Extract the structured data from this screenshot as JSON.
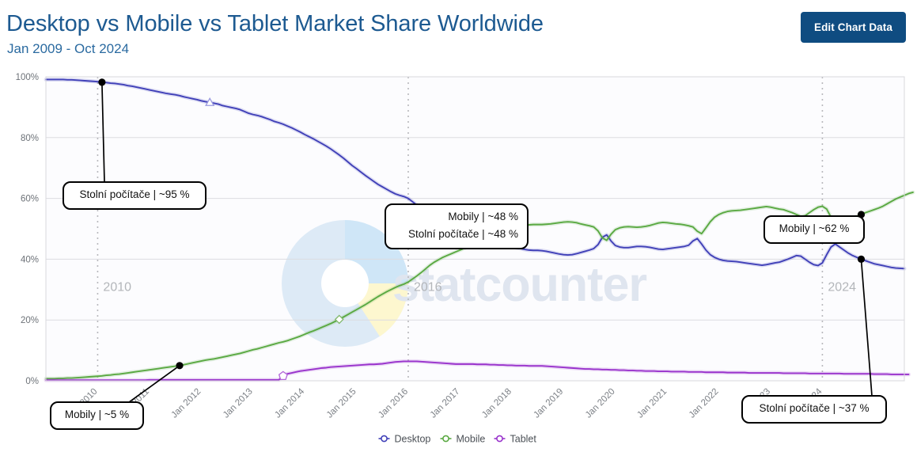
{
  "header": {
    "title": "Desktop vs Mobile vs Tablet Market Share Worldwide",
    "subtitle": "Jan 2009 - Oct 2024",
    "edit_button_label": "Edit Chart Data",
    "title_color": "#1d5a91",
    "button_color": "#0f4c81"
  },
  "watermark": {
    "text": "statcounter"
  },
  "chart_data": {
    "type": "line",
    "title": "Desktop vs Mobile vs Tablet Market Share Worldwide",
    "subtitle": "Jan 2009 - Oct 2024",
    "xlabel": "",
    "ylabel": "",
    "ylim": [
      0,
      100
    ],
    "ytick_labels": [
      "0%",
      "20%",
      "40%",
      "60%",
      "80%",
      "100%"
    ],
    "ytick_values": [
      0,
      20,
      40,
      60,
      80,
      100
    ],
    "grid": true,
    "legend_position": "bottom",
    "x_start": "Jan 2009",
    "x_end": "Oct 2024",
    "xtick_labels": [
      "Jan 2010",
      "Jan 2011",
      "Jan 2012",
      "Jan 2013",
      "Jan 2014",
      "Jan 2015",
      "Jan 2016",
      "Jan 2017",
      "Jan 2018",
      "Jan 2019",
      "Jan 2020",
      "Jan 2021",
      "Jan 2022",
      "Jan 2023",
      "Jan 2024"
    ],
    "vertical_markers": [
      {
        "label": "2010",
        "x_index": 12
      },
      {
        "label": "2016",
        "x_index": 84
      },
      {
        "label": "2024",
        "x_index": 180
      }
    ],
    "series": [
      {
        "name": "Desktop",
        "color": "#4040b8",
        "values": [
          99.1,
          99.1,
          99.1,
          99.1,
          99.1,
          99.0,
          99.0,
          98.9,
          98.8,
          98.7,
          98.6,
          98.5,
          98.4,
          98.2,
          98.1,
          97.9,
          97.8,
          97.6,
          97.4,
          97.1,
          96.9,
          96.6,
          96.3,
          96.0,
          95.7,
          95.4,
          95.1,
          94.8,
          94.5,
          94.3,
          94.1,
          93.8,
          93.4,
          93.1,
          92.8,
          92.5,
          92.1,
          91.8,
          91.6,
          91.3,
          91.0,
          90.5,
          90.2,
          89.9,
          89.6,
          89.2,
          88.6,
          88.0,
          87.6,
          87.3,
          86.9,
          86.4,
          85.9,
          85.3,
          84.9,
          84.4,
          83.8,
          83.2,
          82.5,
          81.8,
          81.0,
          80.3,
          79.6,
          78.8,
          78.0,
          77.2,
          76.3,
          75.3,
          74.3,
          73.2,
          72.0,
          70.8,
          69.8,
          68.7,
          67.6,
          66.6,
          65.6,
          64.6,
          63.8,
          63.0,
          62.2,
          61.5,
          61.0,
          60.6,
          60.0,
          58.9,
          57.8,
          56.6,
          55.3,
          54.1,
          53.2,
          52.6,
          52.0,
          51.6,
          51.2,
          50.9,
          50.5,
          50.0,
          49.5,
          48.8,
          48.0,
          47.2,
          46.5,
          46.0,
          45.6,
          45.2,
          44.8,
          44.4,
          44.1,
          43.8,
          43.5,
          43.2,
          43.0,
          42.9,
          42.9,
          42.8,
          42.6,
          42.3,
          42.0,
          41.7,
          41.5,
          41.4,
          41.5,
          41.8,
          42.2,
          42.6,
          43.0,
          43.5,
          44.8,
          47.2,
          48.0,
          46.0,
          44.5,
          44.0,
          43.8,
          43.8,
          44.0,
          44.2,
          44.2,
          44.1,
          43.9,
          43.6,
          43.3,
          43.2,
          43.4,
          43.6,
          43.8,
          44.0,
          44.2,
          44.6,
          46.0,
          46.8,
          45.0,
          43.0,
          41.5,
          40.6,
          40.0,
          39.6,
          39.4,
          39.3,
          39.2,
          39.0,
          38.8,
          38.6,
          38.4,
          38.2,
          38.0,
          38.2,
          38.5,
          38.8,
          39.0,
          39.5,
          40.0,
          40.6,
          41.2,
          41.0,
          40.0,
          39.0,
          38.2,
          37.9,
          38.8,
          41.5,
          44.0,
          45.0,
          44.0,
          43.0,
          42.0,
          41.2,
          40.6,
          40.0,
          39.5,
          39.0,
          38.5,
          38.2,
          37.9,
          37.6,
          37.3,
          37.1,
          37.0,
          36.9
        ]
      },
      {
        "name": "Mobile",
        "color": "#5aa942",
        "values": [
          0.7,
          0.7,
          0.7,
          0.8,
          0.8,
          0.9,
          0.9,
          1.0,
          1.1,
          1.2,
          1.3,
          1.4,
          1.5,
          1.6,
          1.8,
          1.9,
          2.1,
          2.2,
          2.4,
          2.6,
          2.8,
          3.0,
          3.2,
          3.4,
          3.6,
          3.8,
          4.0,
          4.2,
          4.4,
          4.6,
          4.8,
          5.0,
          5.3,
          5.6,
          5.9,
          6.2,
          6.5,
          6.8,
          7.0,
          7.2,
          7.5,
          7.8,
          8.1,
          8.4,
          8.7,
          9.0,
          9.4,
          9.8,
          10.2,
          10.5,
          10.9,
          11.3,
          11.7,
          12.1,
          12.5,
          12.8,
          13.2,
          13.7,
          14.2,
          14.7,
          15.3,
          15.9,
          16.4,
          17.0,
          17.6,
          18.2,
          18.8,
          19.5,
          20.2,
          21.0,
          21.8,
          22.6,
          23.4,
          24.2,
          25.0,
          25.9,
          26.8,
          27.7,
          28.5,
          29.3,
          30.0,
          30.7,
          31.3,
          31.8,
          32.5,
          33.5,
          34.5,
          35.6,
          36.8,
          38.0,
          39.0,
          39.8,
          40.6,
          41.2,
          41.8,
          42.4,
          43.0,
          43.6,
          44.3,
          45.0,
          45.8,
          46.6,
          47.3,
          47.9,
          48.4,
          48.9,
          49.4,
          49.8,
          50.2,
          50.5,
          50.8,
          51.1,
          51.3,
          51.4,
          51.4,
          51.4,
          51.5,
          51.6,
          51.8,
          52.0,
          52.2,
          52.3,
          52.2,
          52.0,
          51.6,
          51.3,
          51.0,
          50.6,
          49.3,
          47.0,
          46.2,
          48.2,
          49.7,
          50.3,
          50.6,
          50.7,
          50.6,
          50.5,
          50.6,
          50.8,
          51.1,
          51.5,
          51.9,
          52.1,
          52.0,
          51.8,
          51.6,
          51.5,
          51.3,
          51.0,
          50.6,
          49.2,
          48.4,
          50.3,
          52.3,
          53.8,
          54.7,
          55.3,
          55.7,
          55.9,
          56.0,
          56.1,
          56.3,
          56.5,
          56.7,
          56.9,
          57.1,
          57.3,
          57.1,
          56.8,
          56.5,
          56.3,
          55.8,
          55.3,
          54.7,
          54.1,
          54.3,
          55.3,
          56.3,
          57.1,
          57.4,
          56.5,
          53.8,
          51.3,
          50.3,
          51.3,
          52.3,
          53.3,
          54.1,
          54.7,
          55.3,
          55.8,
          56.3,
          56.8,
          57.4,
          58.2,
          59.0,
          59.8,
          60.4,
          61.0,
          61.6,
          62.0
        ]
      },
      {
        "name": "Tablet",
        "color": "#9933cc",
        "values": [
          0.2,
          0.2,
          0.2,
          0.2,
          0.2,
          0.2,
          0.2,
          0.2,
          0.2,
          0.2,
          0.2,
          0.2,
          0.2,
          0.2,
          0.2,
          0.2,
          0.2,
          0.2,
          0.2,
          0.2,
          0.2,
          0.2,
          0.2,
          0.2,
          0.3,
          0.3,
          0.3,
          0.3,
          0.3,
          0.3,
          0.3,
          0.3,
          0.3,
          0.3,
          0.3,
          0.3,
          0.3,
          0.3,
          0.3,
          0.3,
          0.3,
          0.3,
          0.3,
          0.3,
          0.3,
          0.3,
          0.3,
          0.3,
          0.3,
          0.3,
          0.3,
          0.3,
          0.3,
          0.3,
          0.3,
          1.6,
          2.3,
          2.6,
          2.9,
          3.2,
          3.4,
          3.6,
          3.8,
          4.0,
          4.2,
          4.3,
          4.5,
          4.6,
          4.7,
          4.8,
          4.9,
          5.0,
          5.1,
          5.2,
          5.3,
          5.4,
          5.4,
          5.5,
          5.6,
          5.8,
          6.0,
          6.2,
          6.3,
          6.4,
          6.4,
          6.4,
          6.4,
          6.3,
          6.2,
          6.1,
          6.0,
          5.9,
          5.8,
          5.7,
          5.6,
          5.5,
          5.5,
          5.5,
          5.5,
          5.5,
          5.4,
          5.4,
          5.4,
          5.3,
          5.3,
          5.2,
          5.2,
          5.1,
          5.1,
          5.0,
          5.0,
          5.0,
          4.9,
          4.9,
          4.9,
          4.9,
          4.8,
          4.7,
          4.6,
          4.5,
          4.4,
          4.3,
          4.2,
          4.1,
          4.0,
          3.9,
          3.9,
          3.8,
          3.8,
          3.7,
          3.7,
          3.6,
          3.6,
          3.5,
          3.5,
          3.4,
          3.4,
          3.3,
          3.3,
          3.2,
          3.2,
          3.2,
          3.1,
          3.1,
          3.1,
          3.0,
          3.0,
          3.0,
          3.0,
          2.9,
          2.9,
          2.9,
          2.9,
          2.8,
          2.8,
          2.8,
          2.8,
          2.8,
          2.7,
          2.7,
          2.7,
          2.7,
          2.7,
          2.6,
          2.6,
          2.6,
          2.6,
          2.6,
          2.6,
          2.6,
          2.6,
          2.5,
          2.5,
          2.5,
          2.5,
          2.5,
          2.5,
          2.4,
          2.4,
          2.4,
          2.4,
          2.4,
          2.4,
          2.4,
          2.4,
          2.3,
          2.3,
          2.3,
          2.3,
          2.3,
          2.3,
          2.3,
          2.2,
          2.2,
          2.2,
          2.2,
          2.1,
          2.1,
          2.1,
          2.1,
          2.1
        ]
      }
    ],
    "annotations": [
      {
        "id": "a1",
        "lines": [
          "Stolní počítače | ~95 %"
        ],
        "point_index": 13,
        "point_series": "Desktop"
      },
      {
        "id": "a2",
        "lines": [
          "Mobily | ~5 %"
        ],
        "point_index": 31,
        "point_series": "Mobile"
      },
      {
        "id": "a3",
        "lines": [
          "Mobily | ~48 %",
          "Stolní počítače | ~48 %"
        ],
        "point_index": 94,
        "point_series": "Desktop"
      },
      {
        "id": "a4",
        "lines": [
          "Mobily | ~62 %"
        ],
        "point_index": 189,
        "point_series": "Mobile"
      },
      {
        "id": "a5",
        "lines": [
          "Stolní počítače | ~37 %"
        ],
        "point_index": 189,
        "point_series": "Desktop"
      }
    ],
    "legend": [
      {
        "label": "Desktop",
        "color": "#4040b8"
      },
      {
        "label": "Mobile",
        "color": "#5aa942"
      },
      {
        "label": "Tablet",
        "color": "#9933cc"
      }
    ]
  }
}
